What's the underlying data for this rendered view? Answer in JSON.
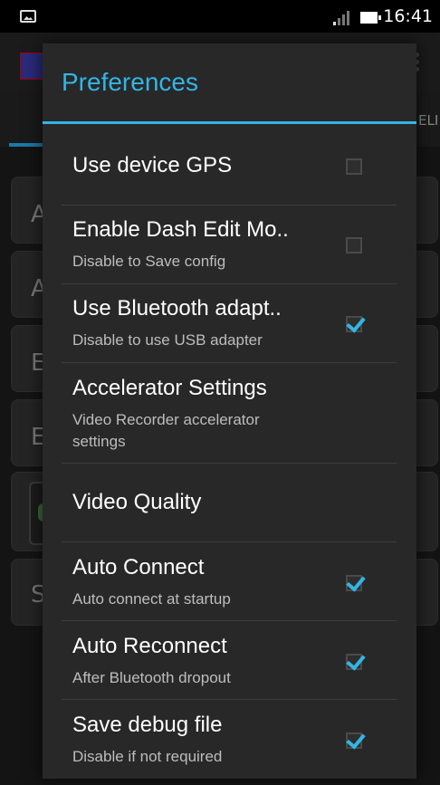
{
  "status_bar": {
    "time": "16:41",
    "image_icon": "image-icon",
    "signal_icon": "signal-icon",
    "battery_icon": "battery-icon"
  },
  "background_app": {
    "tab_partial_text": "ELI",
    "card_letters": [
      "A",
      "A",
      "E",
      "E",
      "S"
    ]
  },
  "dialog": {
    "title": "Preferences",
    "accent_color": "#33b5e5",
    "items": [
      {
        "title": "Use device GPS",
        "summary": "",
        "checkbox": true,
        "checked": false
      },
      {
        "title": "Enable Dash Edit Mo..",
        "summary": "Disable to Save config",
        "checkbox": true,
        "checked": false
      },
      {
        "title": "Use Bluetooth adapt..",
        "summary": "Disable to use USB adapter",
        "checkbox": true,
        "checked": true
      },
      {
        "title": "Accelerator Settings",
        "summary_line1": "Video Recorder accelerator",
        "summary_line2": "settings",
        "checkbox": false
      },
      {
        "title": "Video Quality",
        "summary": "",
        "checkbox": false
      },
      {
        "title": "Auto Connect",
        "summary": "Auto connect at startup",
        "checkbox": true,
        "checked": true
      },
      {
        "title": "Auto Reconnect",
        "summary": "After Bluetooth dropout",
        "checkbox": true,
        "checked": true
      },
      {
        "title": "Save debug file",
        "summary": "Disable if not required",
        "checkbox": true,
        "checked": true
      }
    ]
  }
}
